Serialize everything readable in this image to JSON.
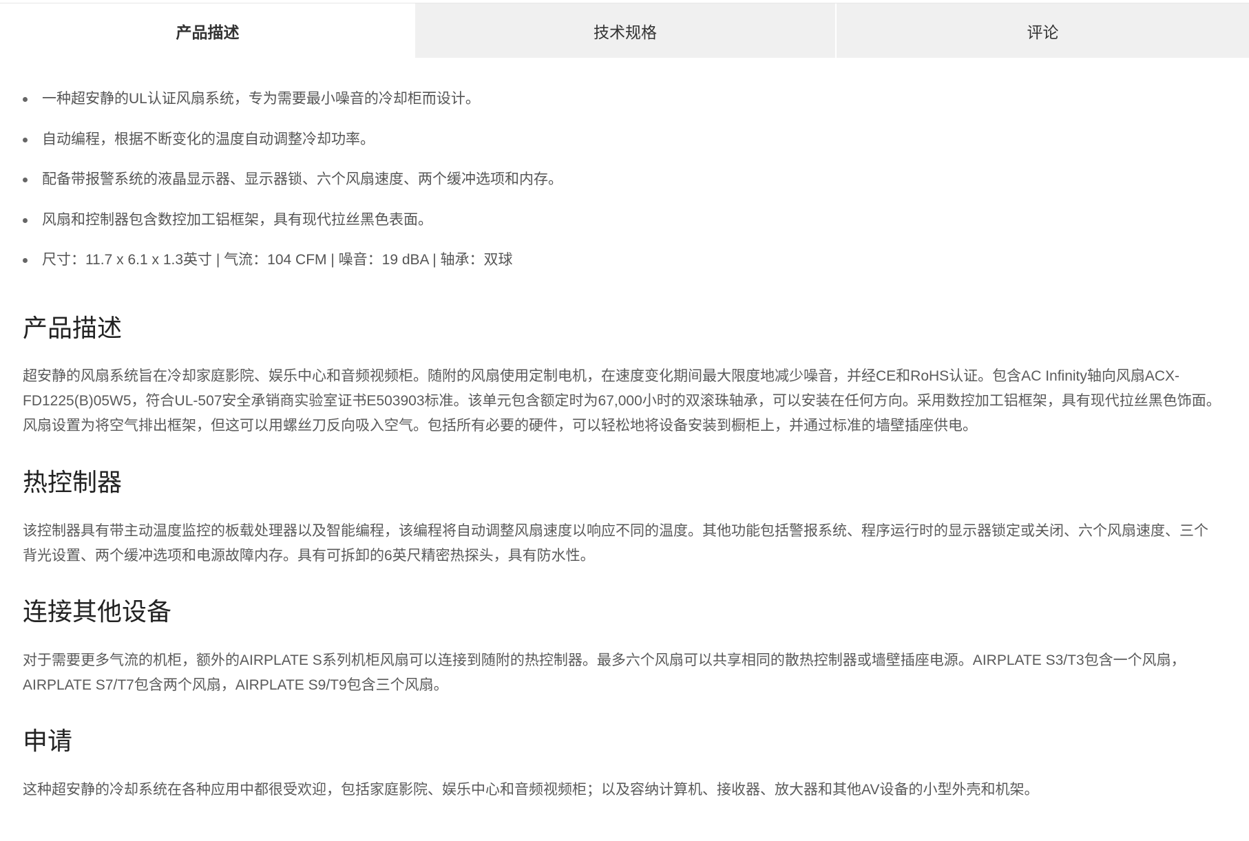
{
  "tabs": [
    {
      "label": "产品描述",
      "active": true
    },
    {
      "label": "技术规格",
      "active": false
    },
    {
      "label": "评论",
      "active": false
    }
  ],
  "features": [
    "一种超安静的UL认证风扇系统，专为需要最小噪音的冷却柜而设计。",
    "自动编程，根据不断变化的温度自动调整冷却功率。",
    "配备带报警系统的液晶显示器、显示器锁、六个风扇速度、两个缓冲选项和内存。",
    "风扇和控制器包含数控加工铝框架，具有现代拉丝黑色表面。",
    "尺寸：11.7 x 6.1 x 1.3英寸 | 气流：104 CFM | 噪音：19 dBA | 轴承：双球"
  ],
  "sections": [
    {
      "heading": "产品描述",
      "body": "超安静的风扇系统旨在冷却家庭影院、娱乐中心和音频视频柜。随附的风扇使用定制电机，在速度变化期间最大限度地减少噪音，并经CE和RoHS认证。包含AC Infinity轴向风扇ACX-FD1225(B)05W5，符合UL-507安全承销商实验室证书E503903标准。该单元包含额定时为67,000小时的双滚珠轴承，可以安装在任何方向。采用数控加工铝框架，具有现代拉丝黑色饰面。风扇设置为将空气排出框架，但这可以用螺丝刀反向吸入空气。包括所有必要的硬件，可以轻松地将设备安装到橱柜上，并通过标准的墙壁插座供电。"
    },
    {
      "heading": "热控制器",
      "body": "该控制器具有带主动温度监控的板载处理器以及智能编程，该编程将自动调整风扇速度以响应不同的温度。其他功能包括警报系统、程序运行时的显示器锁定或关闭、六个风扇速度、三个背光设置、两个缓冲选项和电源故障内存。具有可拆卸的6英尺精密热探头，具有防水性。"
    },
    {
      "heading": "连接其他设备",
      "body": "对于需要更多气流的机柜，额外的AIRPLATE S系列机柜风扇可以连接到随附的热控制器。最多六个风扇可以共享相同的散热控制器或墙壁插座电源。AIRPLATE S3/T3包含一个风扇，AIRPLATE S7/T7包含两个风扇，AIRPLATE S9/T9包含三个风扇。"
    },
    {
      "heading": "申请",
      "body": "这种超安静的冷却系统在各种应用中都很受欢迎，包括家庭影院、娱乐中心和音频视频柜；以及容纳计算机、接收器、放大器和其他AV设备的小型外壳和机架。"
    }
  ]
}
